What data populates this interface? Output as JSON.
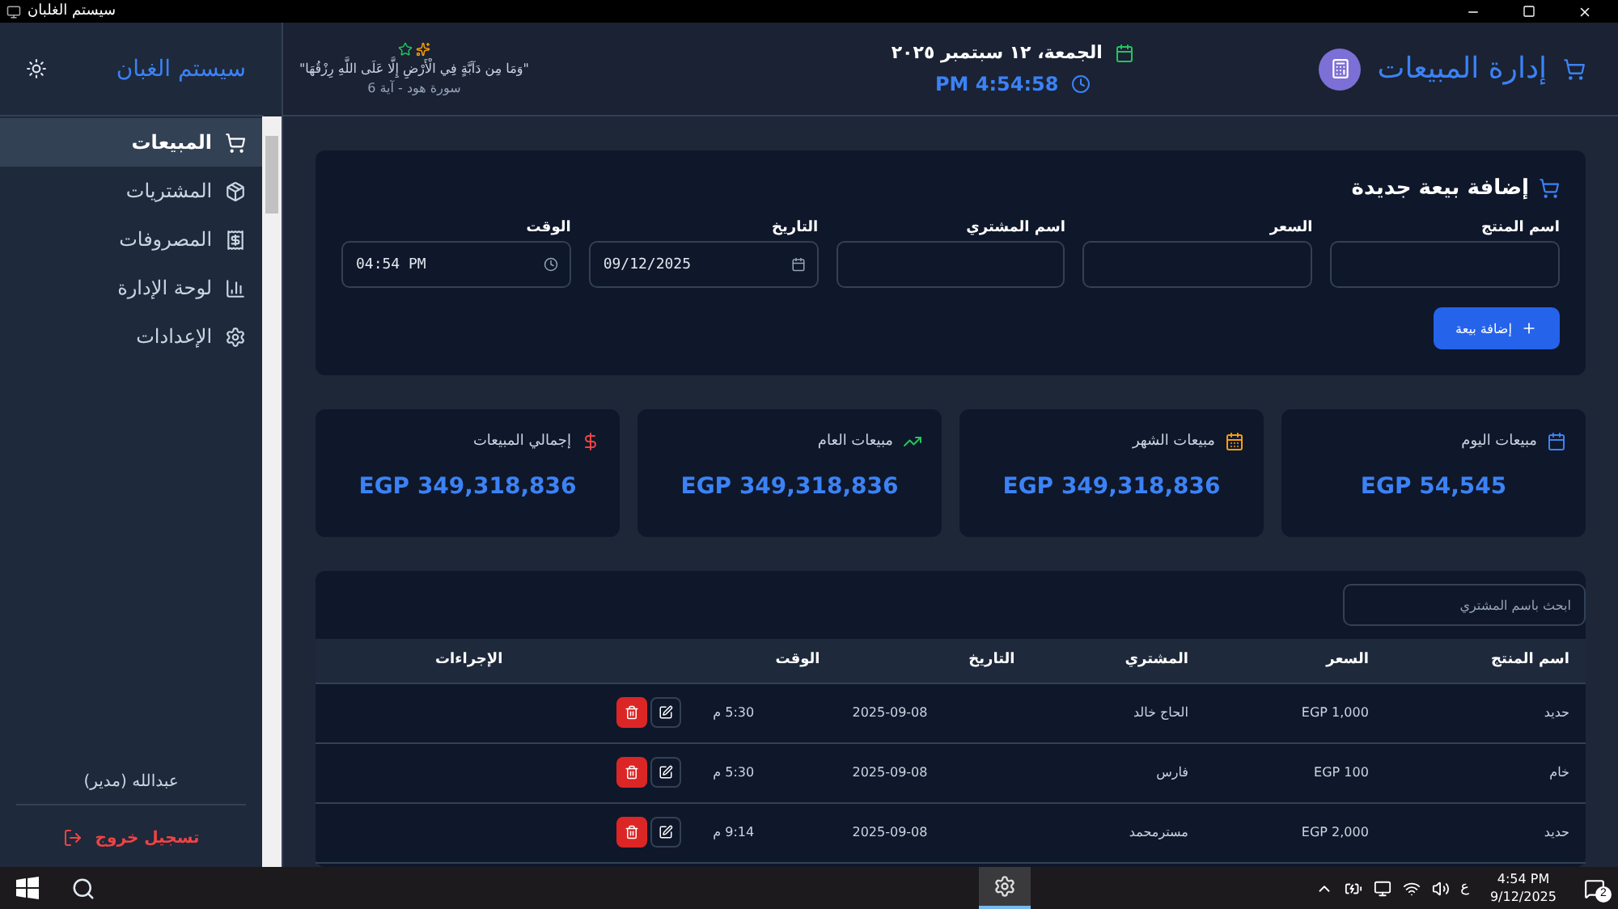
{
  "window": {
    "title": "سيستم الغلبان"
  },
  "sidebar": {
    "brand": "سيستم الغبان",
    "items": [
      {
        "label": "المبيعات",
        "selected": true
      },
      {
        "label": "المشتريات",
        "selected": false
      },
      {
        "label": "المصروفات",
        "selected": false
      },
      {
        "label": "لوحة الإدارة",
        "selected": false
      },
      {
        "label": "الإعدادات",
        "selected": false
      }
    ],
    "user": "عبدالله (مدير)",
    "logout": "تسجيل خروج"
  },
  "header": {
    "title": "إدارة المبيعات",
    "date": "الجمعة، ١٢ سبتمبر ٢٠٢٥",
    "time": "PM 4:54:58",
    "quote": "\"وَمَا مِن دَآبَّةٍ فِي الْأَرْضِ إِلَّا عَلَى اللَّهِ رِزْقُهَا\"",
    "quote_source": "سورة هود - آية 6"
  },
  "form": {
    "title": "إضافة بيعة جديدة",
    "fields": [
      {
        "label": "اسم المنتج"
      },
      {
        "label": "السعر"
      },
      {
        "label": "اسم المشتري"
      },
      {
        "label": "التاريخ",
        "value": "09/12/2025"
      },
      {
        "label": "الوقت",
        "value": "04:54 PM"
      }
    ],
    "submit": "إضافة بيعة"
  },
  "stats": [
    {
      "label": "مبيعات اليوم",
      "value": "EGP 54,545",
      "color": "#3b82f6"
    },
    {
      "label": "مبيعات الشهر",
      "value": "EGP 349,318,836",
      "color": "#f59e0b"
    },
    {
      "label": "مبيعات العام",
      "value": "EGP 349,318,836",
      "color": "#22c55e"
    },
    {
      "label": "إجمالي المبيعات",
      "value": "EGP 349,318,836",
      "color": "#ef4444"
    }
  ],
  "search": {
    "placeholder": "ابحث باسم المشتري"
  },
  "table": {
    "columns": [
      "اسم المنتج",
      "السعر",
      "المشتري",
      "التاريخ",
      "الوقت",
      "الإجراءات"
    ],
    "rows": [
      [
        "حديد",
        "EGP 1,000",
        "الحاج خالد",
        "2025-09-08",
        "5:30 م"
      ],
      [
        "خام",
        "EGP 100",
        "فارس",
        "2025-09-08",
        "5:30 م"
      ],
      [
        "حديد",
        "EGP 2,000",
        "مسترمحمد",
        "2025-09-08",
        "9:14 م"
      ]
    ]
  },
  "taskbar": {
    "language": "ع",
    "time": "4:54 PM",
    "date": "9/12/2025",
    "notifications": "2"
  }
}
